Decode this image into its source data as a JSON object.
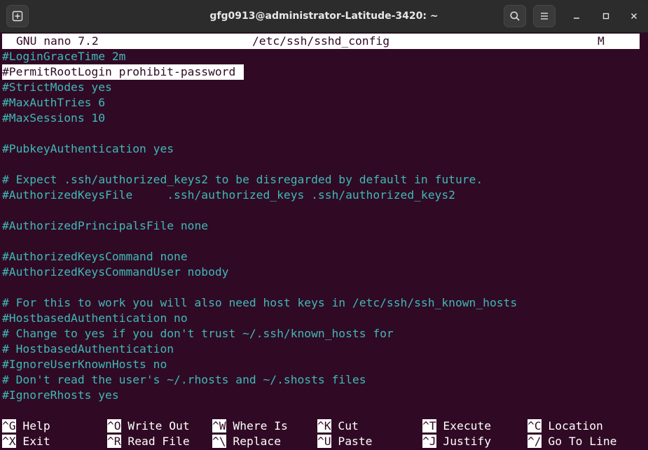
{
  "window": {
    "title": "gfg0913@administrator-Latitude-3420: ~"
  },
  "nano": {
    "version": "GNU nano 7.2",
    "filename": "/etc/ssh/sshd_config",
    "modified": "M"
  },
  "lines": [
    "#LoginGraceTime 2m",
    "#PermitRootLogin prohibit-password",
    "#StrictModes yes",
    "#MaxAuthTries 6",
    "#MaxSessions 10",
    "",
    "#PubkeyAuthentication yes",
    "",
    "# Expect .ssh/authorized_keys2 to be disregarded by default in future.",
    "#AuthorizedKeysFile     .ssh/authorized_keys .ssh/authorized_keys2",
    "",
    "#AuthorizedPrincipalsFile none",
    "",
    "#AuthorizedKeysCommand none",
    "#AuthorizedKeysCommandUser nobody",
    "",
    "# For this to work you will also need host keys in /etc/ssh/ssh_known_hosts",
    "#HostbasedAuthentication no",
    "# Change to yes if you don't trust ~/.ssh/known_hosts for",
    "# HostbasedAuthentication",
    "#IgnoreUserKnownHosts no",
    "# Don't read the user's ~/.rhosts and ~/.shosts files",
    "#IgnoreRhosts yes"
  ],
  "shortcuts": [
    [
      {
        "key": "^G",
        "label": "Help"
      },
      {
        "key": "^O",
        "label": "Write Out"
      },
      {
        "key": "^W",
        "label": "Where Is"
      },
      {
        "key": "^K",
        "label": "Cut"
      },
      {
        "key": "^T",
        "label": "Execute"
      },
      {
        "key": "^C",
        "label": "Location"
      }
    ],
    [
      {
        "key": "^X",
        "label": "Exit"
      },
      {
        "key": "^R",
        "label": "Read File"
      },
      {
        "key": "^\\",
        "label": "Replace"
      },
      {
        "key": "^U",
        "label": "Paste"
      },
      {
        "key": "^J",
        "label": "Justify"
      },
      {
        "key": "^/",
        "label": "Go To Line"
      }
    ]
  ],
  "colors": {
    "terminal_bg": "#300a24",
    "text": "#3fb9b9",
    "titlebar": "#2c2c2c"
  },
  "icons": {
    "new_tab": "new-tab-icon",
    "search": "search-icon",
    "menu": "hamburger-menu-icon",
    "minimize": "minimize-icon",
    "maximize": "maximize-icon",
    "close": "close-icon"
  }
}
